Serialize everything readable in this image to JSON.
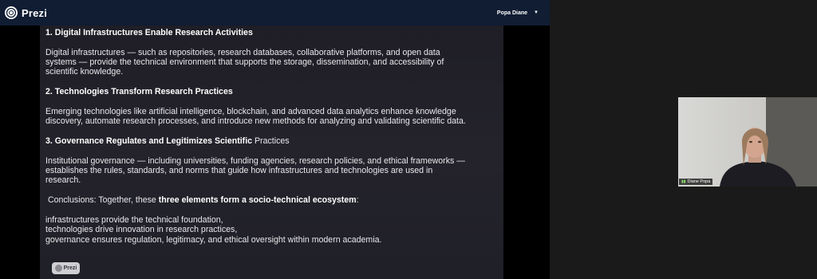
{
  "app": {
    "name": "Prezi"
  },
  "header": {
    "user_name": "Popa Diane"
  },
  "slide": {
    "h1": "1. Digital Infrastructures Enable Research Activities",
    "p1": "Digital infrastructures — such as repositories, research databases, collaborative platforms, and open data systems — provide the technical environment that supports the storage, dissemination, and accessibility of scientific knowledge.",
    "h2": "2. Technologies Transform Research Practices",
    "p2": "Emerging technologies like artificial intelligence, blockchain, and advanced data analytics enhance knowledge discovery, automate research processes, and introduce new methods for analyzing and validating scientific data.",
    "h3_bold": "3. Governance Regulates and Legitimizes Scientific",
    "h3_rest": " Practices",
    "p3": "Institutional governance — including universities, funding agencies, research policies, and ethical frameworks — establishes the rules, standards, and norms that guide how infrastructures and technologies are used in research.",
    "conclusion_prefix": " Conclusions: Together, these ",
    "conclusion_bold": "three elements form a socio-technical ecosystem",
    "conclusion_suffix": ":",
    "bullets": [
      "infrastructures provide the technical foundation,",
      "technologies drive innovation in research practices,",
      "governance ensures regulation, legitimacy, and ethical oversight within modern academia."
    ],
    "badge": "Prezi"
  },
  "video": {
    "participant_name": "Diane Popa"
  },
  "colors": {
    "topbar": "#101d33",
    "slide_bg": "#22212a"
  }
}
